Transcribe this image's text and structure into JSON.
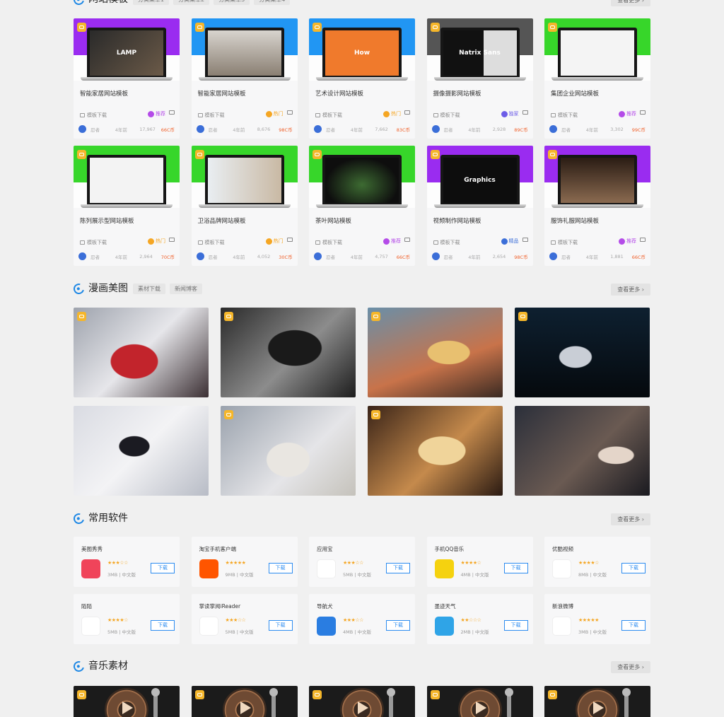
{
  "website_section": {
    "title": "网站模板",
    "tags": [
      "分类菜单1",
      "分类菜单2",
      "分类菜单3",
      "分类菜单4"
    ],
    "more": "查看更多 ›",
    "cards": [
      {
        "title": "智能家居网站模板",
        "screen": "LAMP",
        "category": "模板下载",
        "flag": "推荐",
        "author": "忍者",
        "time": "4年前",
        "views": "17,967",
        "price": "66C币",
        "band": "#9a2cf0",
        "flag_color": "#b44be8"
      },
      {
        "title": "智能家居网站模板",
        "screen": "",
        "category": "模板下载",
        "flag": "热门",
        "author": "忍者",
        "time": "4年前",
        "views": "8,676",
        "price": "98C币",
        "band": "#2196f3",
        "flag_color": "#f5a623"
      },
      {
        "title": "艺术设计网站模板",
        "screen": "How",
        "category": "模板下载",
        "flag": "热门",
        "author": "忍者",
        "time": "4年前",
        "views": "7,662",
        "price": "83C币",
        "band": "#2196f3",
        "flag_color": "#f5a623"
      },
      {
        "title": "摄像摄影网站模板",
        "screen": "Natrix Sans",
        "category": "模板下载",
        "flag": "独家",
        "author": "忍者",
        "time": "4年前",
        "views": "2,928",
        "price": "89C币",
        "band": "#555555",
        "flag_color": "#6c5ce7"
      },
      {
        "title": "集团企业网站模板",
        "screen": "",
        "category": "模板下载",
        "flag": "推荐",
        "author": "忍者",
        "time": "4年前",
        "views": "3,302",
        "price": "99C币",
        "band": "#37d62a",
        "flag_color": "#b44be8"
      },
      {
        "title": "陈列展示型网站模板",
        "screen": "",
        "category": "模板下载",
        "flag": "热门",
        "author": "忍者",
        "time": "4年前",
        "views": "2,964",
        "price": "70C币",
        "band": "#37d62a",
        "flag_color": "#f5a623"
      },
      {
        "title": "卫浴品牌网站模板",
        "screen": "",
        "category": "模板下载",
        "flag": "热门",
        "author": "忍者",
        "time": "4年前",
        "views": "4,052",
        "price": "30C币",
        "band": "#37d62a",
        "flag_color": "#f5a623"
      },
      {
        "title": "茶叶网站模板",
        "screen": "",
        "category": "模板下载",
        "flag": "推荐",
        "author": "忍者",
        "time": "4年前",
        "views": "4,757",
        "price": "66C币",
        "band": "#37d62a",
        "flag_color": "#b44be8"
      },
      {
        "title": "视频制作网站模板",
        "screen": "Graphics",
        "category": "模板下载",
        "flag": "精品",
        "author": "忍者",
        "time": "4年前",
        "views": "2,654",
        "price": "98C币",
        "band": "#9a2cf0",
        "flag_color": "#3b6ed8"
      },
      {
        "title": "服饰礼服网站模板",
        "screen": "",
        "category": "模板下载",
        "flag": "推荐",
        "author": "忍者",
        "time": "4年前",
        "views": "1,881",
        "price": "66C币",
        "band": "#9a2cf0",
        "flag_color": "#b44be8"
      }
    ]
  },
  "manga_section": {
    "title": "漫画美图",
    "tags": [
      "素材下载",
      "新闻博客"
    ],
    "more": "查看更多 ›",
    "images": [
      "anime-girl-red-uniform",
      "gothic-girl-dark-room",
      "girl-street-food",
      "underwater-girl",
      "fox-girl-white-dress",
      "white-hair-elf-girl",
      "girl-sleeping-sunlight",
      "girl-city-night-window"
    ]
  },
  "software_section": {
    "title": "常用软件",
    "more": "查看更多 ›",
    "download_label": "下载",
    "items": [
      {
        "name": "美图秀秀",
        "stars": "★★★☆☆",
        "size": "3MB",
        "lang": "中文版",
        "icon": "meitu-icon",
        "color": "#f0445a"
      },
      {
        "name": "淘宝手机客户端",
        "stars": "★★★★★",
        "size": "9MB",
        "lang": "中文版",
        "icon": "taobao-icon",
        "color": "#ff5500"
      },
      {
        "name": "应用宝",
        "stars": "★★★☆☆",
        "size": "5MB",
        "lang": "中文版",
        "icon": "yingyongbao-icon",
        "color": "#ffffff"
      },
      {
        "name": "手机QQ音乐",
        "stars": "★★★★☆",
        "size": "4MB",
        "lang": "中文版",
        "icon": "qqmusic-icon",
        "color": "#f5d20f"
      },
      {
        "name": "优酷视频",
        "stars": "★★★★☆",
        "size": "8MB",
        "lang": "中文版",
        "icon": "youku-icon",
        "color": "#ffffff"
      },
      {
        "name": "陌陌",
        "stars": "★★★★☆",
        "size": "5MB",
        "lang": "中文版",
        "icon": "momo-icon",
        "color": "#ffffff"
      },
      {
        "name": "掌读掌阅iReader",
        "stars": "★★★☆☆",
        "size": "5MB",
        "lang": "中文版",
        "icon": "ireader-icon",
        "color": "#ffffff"
      },
      {
        "name": "导航犬",
        "stars": "★★★☆☆",
        "size": "4MB",
        "lang": "中文版",
        "icon": "daohangquan-icon",
        "color": "#2a7de1"
      },
      {
        "name": "墨迹天气",
        "stars": "★★☆☆☆",
        "size": "2MB",
        "lang": "中文版",
        "icon": "moji-icon",
        "color": "#2fa4e7"
      },
      {
        "name": "新浪微博",
        "stars": "★★★★★",
        "size": "3MB",
        "lang": "中文版",
        "icon": "weibo-icon",
        "color": "#ffffff"
      }
    ]
  },
  "music_section": {
    "title": "音乐素材",
    "more": "查看更多 ›"
  }
}
